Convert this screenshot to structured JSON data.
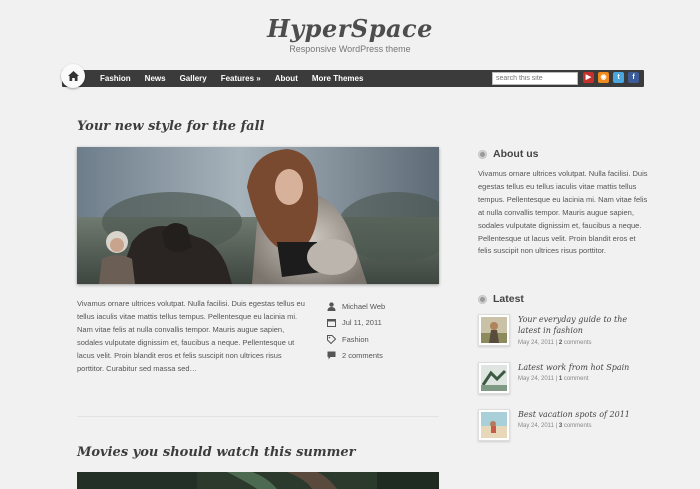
{
  "site": {
    "title": "HyperSpace",
    "tagline": "Responsive WordPress theme"
  },
  "nav": {
    "home_icon": "home-icon",
    "items": [
      "Fashion",
      "News",
      "Gallery",
      "Features »",
      "About",
      "More Themes"
    ],
    "search_placeholder": "search this site",
    "social": [
      {
        "name": "youtube-icon",
        "color": "#c4302b",
        "glyph": "▶"
      },
      {
        "name": "rss-icon",
        "color": "#f08a1d",
        "glyph": "◉"
      },
      {
        "name": "twitter-icon",
        "color": "#4aa7de",
        "glyph": "t"
      },
      {
        "name": "facebook-icon",
        "color": "#3b5b99",
        "glyph": "f"
      }
    ]
  },
  "posts": [
    {
      "title": "Your new style for the fall",
      "excerpt": "Vivamus ornare ultrices volutpat. Nulla facilisi. Duis egestas tellus eu tellus iaculis vitae mattis tellus tempus. Pellentesque eu lacinia mi. Nam vitae felis at nulla convallis tempor. Mauris augue sapien, sodales vulputate dignissim et, faucibus a neque. Pellentesque ut lacus velit. Proin blandit eros et felis suscipit non ultrices risus porttitor. Curabitur sed massa sed…",
      "author": "Michael Web",
      "date": "Jul 11, 2011",
      "category": "Fashion",
      "comments": "2 comments"
    },
    {
      "title": "Movies you should watch this summer"
    }
  ],
  "sidebar": {
    "about_title": "About us",
    "about_text": "Vivamus ornare ultrices volutpat. Nulla facilisi. Duis egestas tellus eu tellus iaculis vitae mattis tellus tempus. Pellentesque eu lacinia mi. Nam vitae felis at nulla convallis tempor. Mauris augue sapien, sodales vulputate dignissim et, faucibus a neque. Pellentesque ut lacus velit. Proin blandit eros et felis suscipit non ultrices risus porttitor.",
    "latest_title": "Latest",
    "latest": [
      {
        "title": "Your everyday guide to the latest in fashion",
        "date": "May 24, 2011",
        "comments_count": "2",
        "comments_word": "comments",
        "sep": "|"
      },
      {
        "title": "Latest work from hot Spain",
        "date": "May 24, 2011",
        "comments_count": "1",
        "comments_word": "comment",
        "sep": "|"
      },
      {
        "title": "Best vacation spots of 2011",
        "date": "May 24, 2011",
        "comments_count": "3",
        "comments_word": "comments",
        "sep": "|"
      }
    ]
  }
}
